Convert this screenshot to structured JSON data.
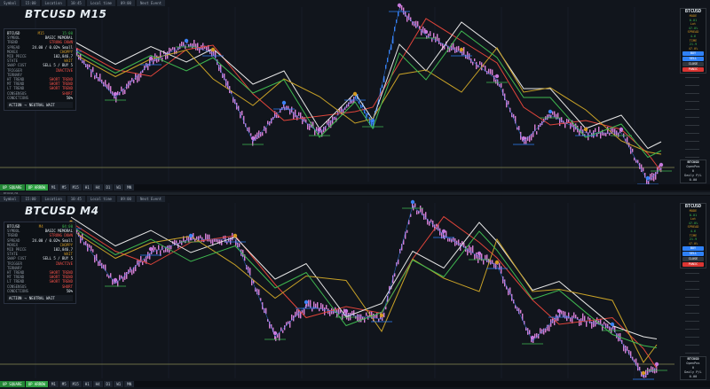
{
  "top": {
    "strip": [
      "Symbol",
      "15:00",
      "Location",
      "10:45",
      "Local time",
      "09:00",
      "Next Event"
    ],
    "title": "BTCUSD M15",
    "panel": {
      "header": [
        "BTCUSD",
        "M15",
        "15:00"
      ],
      "rows": [
        {
          "k": "SYMBOL",
          "v": "BASIC MEMORAL"
        },
        {
          "k": "TREND",
          "v": "STRONG DOWN"
        },
        {
          "k": "SPREAD",
          "v": "24.00 / 0.02% Small"
        },
        {
          "k": "MOVEX",
          "v": "CHOPPY"
        },
        {
          "k": "MID PRICE",
          "v": "102,846.7"
        },
        {
          "k": "STATE",
          "v": "WAIT"
        },
        {
          "k": "SWAP COST",
          "v": "SELL 5 / BUY 5"
        },
        {
          "k": "TRIGGER",
          "v": "INACTIVE"
        },
        {
          "k": "TERNARY",
          "v": ""
        },
        {
          "k": "HT TREND",
          "v": "SHORT TREND"
        },
        {
          "k": "MT TREND",
          "v": "SHORT TREND"
        },
        {
          "k": "LT TREND",
          "v": "SHORT TREND"
        },
        {
          "k": "CONSENSUS",
          "v": "SHORT"
        },
        {
          "k": "CONDITIONS",
          "v": "50%"
        }
      ],
      "action": [
        "ACTION",
        "→",
        "NEUTRAL WAIT"
      ]
    },
    "rightbox": {
      "sym": "BTCUSD",
      "items": [
        "MODE",
        "0.01",
        "Lot",
        "47.0%",
        "SPREAD",
        "4.6",
        "TIME",
        "21.9",
        "47.0%"
      ],
      "buttons": [
        "BUY",
        "SELL",
        "CLOSE",
        "PANIC"
      ]
    },
    "lowerbox": [
      "BTCUSD",
      "OpenPos",
      "0",
      "Daily P/L",
      "0.00"
    ],
    "tfbar": [
      "UP SQUARE",
      "UP ARROW",
      "M1",
      "M5",
      "M15",
      "H1",
      "H4",
      "D1",
      "W1",
      "MN"
    ]
  },
  "divider": "BTCUSD,M4",
  "bottom": {
    "strip": [
      "Symbol",
      "15:00",
      "Location",
      "10:45",
      "Local time",
      "09:00",
      "Next Event"
    ],
    "title": "BTCUSD M4",
    "panel": {
      "header": [
        "BTCUSD",
        "M4",
        "04:00"
      ],
      "rows": [
        {
          "k": "SYMBOL",
          "v": "BASIC MEMORAL"
        },
        {
          "k": "TREND",
          "v": "STRONG DOWN"
        },
        {
          "k": "SPREAD",
          "v": "24.00 / 0.02% Small"
        },
        {
          "k": "MOVEX",
          "v": "CHOPPY"
        },
        {
          "k": "MID PRICE",
          "v": "102,846.7"
        },
        {
          "k": "STATE",
          "v": "WAIT"
        },
        {
          "k": "SWAP COST",
          "v": "SELL 5 / BUY 5"
        },
        {
          "k": "TRIGGER",
          "v": "INACTIVE"
        },
        {
          "k": "TERNARY",
          "v": ""
        },
        {
          "k": "HT TREND",
          "v": "SHORT TREND"
        },
        {
          "k": "MT TREND",
          "v": "SHORT TREND"
        },
        {
          "k": "LT TREND",
          "v": "SHORT TREND"
        },
        {
          "k": "CONSENSUS",
          "v": "SHORT"
        },
        {
          "k": "CONDITIONS",
          "v": "50%"
        }
      ],
      "action": [
        "ACTION",
        "→",
        "NEUTRAL WAIT"
      ]
    },
    "rightbox": {
      "sym": "BTCUSD",
      "items": [
        "MODE",
        "0.01",
        "Lot",
        "47.0%",
        "SPREAD",
        "4.6",
        "TIME",
        "21.9",
        "47.0%"
      ],
      "buttons": [
        "BUY",
        "SELL",
        "CLOSE",
        "PANIC"
      ]
    },
    "lowerbox": [
      "BTCUSD",
      "OpenPos",
      "0",
      "Daily P/L",
      "0.00"
    ],
    "tfbar": [
      "UP SQUARE",
      "UP ARROW",
      "M1",
      "M5",
      "M15",
      "H1",
      "H4",
      "D1",
      "W1",
      "MN"
    ]
  },
  "colors": {
    "bg": "#11151c",
    "candle": "#d67fd6",
    "ema_red": "#e0443a",
    "ema_white": "#e8e8e8",
    "ema_yellow": "#c9a227",
    "ema_green": "#3fb950",
    "blue": "#3b82f6",
    "level": "#2f81f7"
  }
}
